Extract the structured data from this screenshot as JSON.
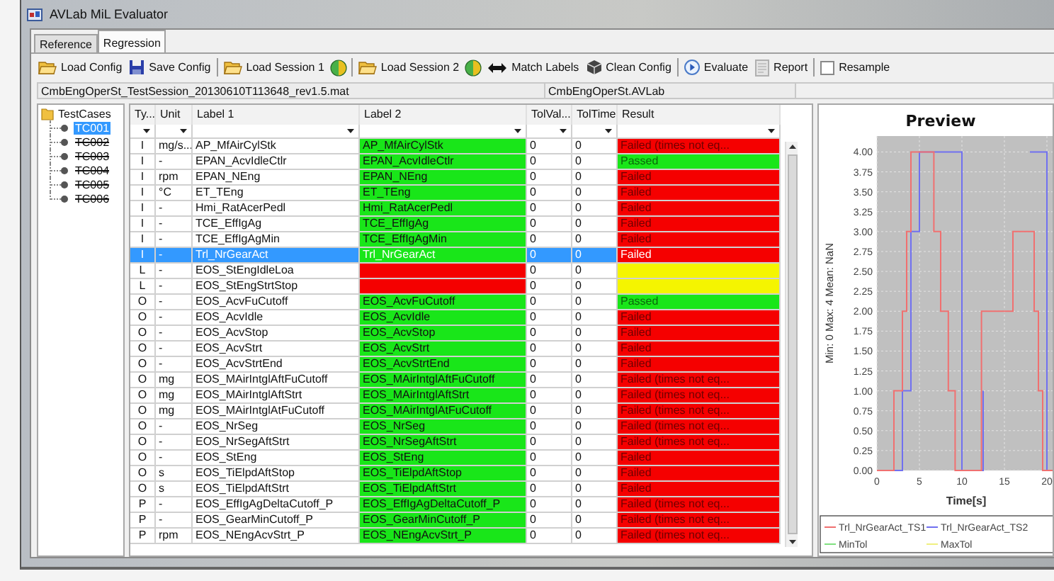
{
  "window": {
    "title": "AVLab MiL Evaluator"
  },
  "tabs": [
    {
      "label": "Reference",
      "selected": false
    },
    {
      "label": "Regression",
      "selected": true
    }
  ],
  "toolbar": [
    {
      "kind": "open",
      "label": "Load Config"
    },
    {
      "kind": "save",
      "label": "Save Config"
    },
    {
      "kind": "separator"
    },
    {
      "kind": "open",
      "label": "Load Session 1"
    },
    {
      "kind": "indicator"
    },
    {
      "kind": "separator"
    },
    {
      "kind": "open",
      "label": "Load Session 2"
    },
    {
      "kind": "indicator"
    },
    {
      "kind": "match",
      "label": "Match Labels"
    },
    {
      "kind": "clean",
      "label": "Clean Config"
    },
    {
      "kind": "separator"
    },
    {
      "kind": "run",
      "label": "Evaluate"
    },
    {
      "kind": "report",
      "label": "Report"
    },
    {
      "kind": "separator"
    },
    {
      "kind": "checkbox",
      "label": "Resample",
      "checked": false
    }
  ],
  "paths": {
    "session": "CmbEngOperSt_TestSession_20130610T113648_rev1.5.mat",
    "config": "CmbEngOperSt.AVLab"
  },
  "tree": {
    "label": "TestCases",
    "children": [
      {
        "label": "TC001",
        "selected": true,
        "excluded": false
      },
      {
        "label": "TC002",
        "selected": false,
        "excluded": true
      },
      {
        "label": "TC003",
        "selected": false,
        "excluded": true
      },
      {
        "label": "TC004",
        "selected": false,
        "excluded": true
      },
      {
        "label": "TC005",
        "selected": false,
        "excluded": true
      },
      {
        "label": "TC006",
        "selected": false,
        "excluded": true
      }
    ]
  },
  "table": {
    "columns": [
      "Ty...",
      "Unit",
      "Label 1",
      "Label 2",
      "TolVal...",
      "TolTime",
      "Result"
    ],
    "rows": [
      {
        "type": "I",
        "unit": "mg/s...",
        "label_1": "AP_MfAirCylStk",
        "label_2": {
          "text": "AP_MfAirCylStk",
          "color": "#19e619"
        },
        "tol_value": "0",
        "tol_time": "0",
        "result": {
          "text": "Failed (times not eq...",
          "color": "#f50000"
        },
        "selected": false
      },
      {
        "type": "I",
        "unit": "-",
        "label_1": "EPAN_AcvIdleCtlr",
        "label_2": {
          "text": "EPAN_AcvIdleCtlr",
          "color": "#19e619"
        },
        "tol_value": "0",
        "tol_time": "0",
        "result": {
          "text": "Passed",
          "color": "#19e619"
        },
        "selected": false
      },
      {
        "type": "I",
        "unit": "rpm",
        "label_1": "EPAN_NEng",
        "label_2": {
          "text": "EPAN_NEng",
          "color": "#19e619"
        },
        "tol_value": "0",
        "tol_time": "0",
        "result": {
          "text": "Failed",
          "color": "#f50000"
        },
        "selected": false
      },
      {
        "type": "I",
        "unit": "°C",
        "label_1": "ET_TEng",
        "label_2": {
          "text": "ET_TEng",
          "color": "#19e619"
        },
        "tol_value": "0",
        "tol_time": "0",
        "result": {
          "text": "Failed",
          "color": "#f50000"
        },
        "selected": false
      },
      {
        "type": "I",
        "unit": "-",
        "label_1": "Hmi_RatAcerPedl",
        "label_2": {
          "text": "Hmi_RatAcerPedl",
          "color": "#19e619"
        },
        "tol_value": "0",
        "tol_time": "0",
        "result": {
          "text": "Failed",
          "color": "#f50000"
        },
        "selected": false
      },
      {
        "type": "I",
        "unit": "-",
        "label_1": "TCE_EffIgAg",
        "label_2": {
          "text": "TCE_EffIgAg",
          "color": "#19e619"
        },
        "tol_value": "0",
        "tol_time": "0",
        "result": {
          "text": "Failed",
          "color": "#f50000"
        },
        "selected": false
      },
      {
        "type": "I",
        "unit": "-",
        "label_1": "TCE_EffIgAgMin",
        "label_2": {
          "text": "TCE_EffIgAgMin",
          "color": "#19e619"
        },
        "tol_value": "0",
        "tol_time": "0",
        "result": {
          "text": "Failed",
          "color": "#f50000"
        },
        "selected": false
      },
      {
        "type": "I",
        "unit": "-",
        "label_1": "Trl_NrGearAct",
        "label_2": {
          "text": "Trl_NrGearAct",
          "color": "#19e619"
        },
        "tol_value": "0",
        "tol_time": "0",
        "result": {
          "text": "Failed",
          "color": "#f50000"
        },
        "selected": true
      },
      {
        "type": "L",
        "unit": "-",
        "label_1": "EOS_StEngIdleLoa",
        "label_2": {
          "color": "#f50000"
        },
        "tol_value": "0",
        "tol_time": "0",
        "result": {
          "color": "#f5f500"
        },
        "selected": false
      },
      {
        "type": "L",
        "unit": "-",
        "label_1": "EOS_StEngStrtStop",
        "label_2": {
          "color": "#f50000"
        },
        "tol_value": "0",
        "tol_time": "0",
        "result": {
          "color": "#f5f500"
        },
        "selected": false
      },
      {
        "type": "O",
        "unit": "-",
        "label_1": "EOS_AcvFuCutoff",
        "label_2": {
          "text": "EOS_AcvFuCutoff",
          "color": "#19e619"
        },
        "tol_value": "0",
        "tol_time": "0",
        "result": {
          "text": "Passed",
          "color": "#19e619"
        },
        "selected": false
      },
      {
        "type": "O",
        "unit": "-",
        "label_1": "EOS_AcvIdle",
        "label_2": {
          "text": "EOS_AcvIdle",
          "color": "#19e619"
        },
        "tol_value": "0",
        "tol_time": "0",
        "result": {
          "text": "Failed",
          "color": "#f50000"
        },
        "selected": false
      },
      {
        "type": "O",
        "unit": "-",
        "label_1": "EOS_AcvStop",
        "label_2": {
          "text": "EOS_AcvStop",
          "color": "#19e619"
        },
        "tol_value": "0",
        "tol_time": "0",
        "result": {
          "text": "Failed",
          "color": "#f50000"
        },
        "selected": false
      },
      {
        "type": "O",
        "unit": "-",
        "label_1": "EOS_AcvStrt",
        "label_2": {
          "text": "EOS_AcvStrt",
          "color": "#19e619"
        },
        "tol_value": "0",
        "tol_time": "0",
        "result": {
          "text": "Failed",
          "color": "#f50000"
        },
        "selected": false
      },
      {
        "type": "O",
        "unit": "-",
        "label_1": "EOS_AcvStrtEnd",
        "label_2": {
          "text": "EOS_AcvStrtEnd",
          "color": "#19e619"
        },
        "tol_value": "0",
        "tol_time": "0",
        "result": {
          "text": "Failed",
          "color": "#f50000"
        },
        "selected": false
      },
      {
        "type": "O",
        "unit": "mg",
        "label_1": "EOS_MAirIntglAftFuCutoff",
        "label_2": {
          "text": "EOS_MAirIntglAftFuCutoff",
          "color": "#19e619"
        },
        "tol_value": "0",
        "tol_time": "0",
        "result": {
          "text": "Failed (times not eq...",
          "color": "#f50000"
        },
        "selected": false
      },
      {
        "type": "O",
        "unit": "mg",
        "label_1": "EOS_MAirIntglAftStrt",
        "label_2": {
          "text": "EOS_MAirIntglAftStrt",
          "color": "#19e619"
        },
        "tol_value": "0",
        "tol_time": "0",
        "result": {
          "text": "Failed (times not eq...",
          "color": "#f50000"
        },
        "selected": false
      },
      {
        "type": "O",
        "unit": "mg",
        "label_1": "EOS_MAirIntglAtFuCutoff",
        "label_2": {
          "text": "EOS_MAirIntglAtFuCutoff",
          "color": "#19e619"
        },
        "tol_value": "0",
        "tol_time": "0",
        "result": {
          "text": "Failed (times not eq...",
          "color": "#f50000"
        },
        "selected": false
      },
      {
        "type": "O",
        "unit": "-",
        "label_1": "EOS_NrSeg",
        "label_2": {
          "text": "EOS_NrSeg",
          "color": "#19e619"
        },
        "tol_value": "0",
        "tol_time": "0",
        "result": {
          "text": "Failed (times not eq...",
          "color": "#f50000"
        },
        "selected": false
      },
      {
        "type": "O",
        "unit": "-",
        "label_1": "EOS_NrSegAftStrt",
        "label_2": {
          "text": "EOS_NrSegAftStrt",
          "color": "#19e619"
        },
        "tol_value": "0",
        "tol_time": "0",
        "result": {
          "text": "Failed (times not eq...",
          "color": "#f50000"
        },
        "selected": false
      },
      {
        "type": "O",
        "unit": "-",
        "label_1": "EOS_StEng",
        "label_2": {
          "text": "EOS_StEng",
          "color": "#19e619"
        },
        "tol_value": "0",
        "tol_time": "0",
        "result": {
          "text": "Failed",
          "color": "#f50000"
        },
        "selected": false
      },
      {
        "type": "O",
        "unit": "s",
        "label_1": "EOS_TiElpdAftStop",
        "label_2": {
          "text": "EOS_TiElpdAftStop",
          "color": "#19e619"
        },
        "tol_value": "0",
        "tol_time": "0",
        "result": {
          "text": "Failed",
          "color": "#f50000"
        },
        "selected": false
      },
      {
        "type": "O",
        "unit": "s",
        "label_1": "EOS_TiElpdAftStrt",
        "label_2": {
          "text": "EOS_TiElpdAftStrt",
          "color": "#19e619"
        },
        "tol_value": "0",
        "tol_time": "0",
        "result": {
          "text": "Failed",
          "color": "#f50000"
        },
        "selected": false
      },
      {
        "type": "P",
        "unit": "-",
        "label_1": "EOS_EffIgAgDeltaCutoff_P",
        "label_2": {
          "text": "EOS_EffIgAgDeltaCutoff_P",
          "color": "#19e619"
        },
        "tol_value": "0",
        "tol_time": "0",
        "result": {
          "text": "Failed (times not eq...",
          "color": "#f50000"
        },
        "selected": false
      },
      {
        "type": "P",
        "unit": "-",
        "label_1": "EOS_GearMinCutoff_P",
        "label_2": {
          "text": "EOS_GearMinCutoff_P",
          "color": "#19e619"
        },
        "tol_value": "0",
        "tol_time": "0",
        "result": {
          "text": "Failed (times not eq...",
          "color": "#f50000"
        },
        "selected": false
      },
      {
        "type": "P",
        "unit": "rpm",
        "label_1": "EOS_NEngAcvStrt_P",
        "label_2": {
          "text": "EOS_NEngAcvStrt_P",
          "color": "#19e619"
        },
        "tol_value": "0",
        "tol_time": "0",
        "result": {
          "text": "Failed (times not eq...",
          "color": "#f50000"
        },
        "selected": false
      }
    ]
  },
  "preview": {
    "chart_data": {
      "type": "line",
      "title": "Preview",
      "xlabel": "Time[s]",
      "ylabel": "Min: 0 Max: 4 Mean: NaN",
      "x": [
        0,
        2,
        2,
        3,
        3,
        3.5,
        3.5,
        4,
        4,
        5,
        5,
        6.7,
        6.7,
        7.5,
        7.5,
        8.4,
        8.4,
        9.2,
        9.2,
        10,
        10,
        12.3,
        12.3,
        12.5,
        12.5,
        16,
        16,
        18,
        18,
        18.5,
        18.5,
        19,
        19,
        19.5,
        19.5,
        20,
        20,
        21
      ],
      "series": [
        {
          "name": "Trl_NrGearAct_TS1",
          "color": "#f07070",
          "values": [
            0,
            0,
            1,
            1,
            2,
            2,
            3,
            3,
            4,
            4,
            4,
            4,
            3,
            3,
            2,
            2,
            1,
            1,
            0,
            0,
            0,
            0,
            2,
            2,
            2,
            2,
            3,
            3,
            3,
            3,
            2,
            2,
            1,
            1,
            0,
            0,
            0,
            0
          ]
        },
        {
          "name": "Trl_NrGearAct_TS2",
          "color": "#7070f0",
          "values": [
            0,
            0,
            0,
            0,
            1,
            1,
            1,
            1,
            3,
            3,
            4,
            4,
            4,
            4,
            4,
            4,
            4,
            4,
            4,
            4,
            0,
            0,
            0,
            0,
            1,
            null,
            null,
            null,
            4,
            4,
            4,
            4,
            4,
            4,
            4,
            4,
            0,
            0
          ]
        },
        {
          "name": "MinTol",
          "color": "#80e080",
          "values": [
            null,
            null,
            null,
            null,
            null,
            null,
            null,
            null,
            null,
            null,
            null,
            null,
            null,
            null,
            null,
            null,
            null,
            null,
            null,
            null,
            null,
            null,
            null,
            null,
            null,
            null,
            null,
            null,
            null,
            null,
            null,
            null,
            null,
            null,
            null,
            null,
            null,
            null
          ]
        },
        {
          "name": "MaxTol",
          "color": "#f0f080",
          "values": [
            null,
            null,
            null,
            null,
            null,
            null,
            null,
            null,
            null,
            null,
            null,
            null,
            null,
            null,
            null,
            null,
            null,
            null,
            null,
            null,
            null,
            null,
            null,
            null,
            null,
            null,
            null,
            null,
            null,
            null,
            null,
            null,
            null,
            null,
            null,
            null,
            null,
            null
          ]
        }
      ],
      "grid": true,
      "legend": true,
      "xlim": [
        0,
        21
      ],
      "ylim": [
        0,
        4.2
      ],
      "xticks": [
        0,
        5,
        10,
        15,
        20
      ],
      "yticks": [
        {
          "value": 0,
          "label": "0.00"
        },
        {
          "value": 0.25,
          "label": "0.25"
        },
        {
          "value": 0.5,
          "label": "0.50"
        },
        {
          "value": 0.75,
          "label": "0.75"
        },
        {
          "value": 1,
          "label": "1.00"
        },
        {
          "value": 1.25,
          "label": "1.25"
        },
        {
          "value": 1.5,
          "label": "1.50"
        },
        {
          "value": 1.75,
          "label": "1.75"
        },
        {
          "value": 2,
          "label": "2.00"
        },
        {
          "value": 2.25,
          "label": "2.25"
        },
        {
          "value": 2.5,
          "label": "2.50"
        },
        {
          "value": 2.75,
          "label": "2.75"
        },
        {
          "value": 3,
          "label": "3.00"
        },
        {
          "value": 3.25,
          "label": "3.25"
        },
        {
          "value": 3.5,
          "label": "3.50"
        },
        {
          "value": 3.75,
          "label": "3.75"
        },
        {
          "value": 4,
          "label": "4.00"
        }
      ]
    }
  }
}
